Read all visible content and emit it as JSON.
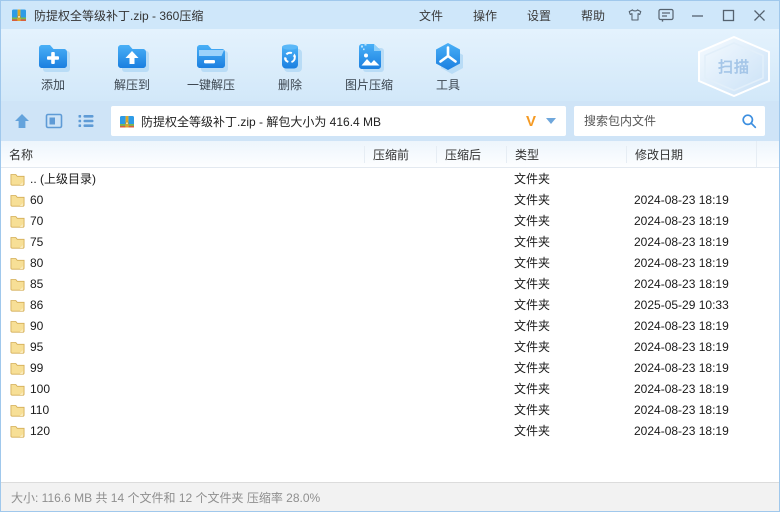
{
  "window": {
    "title": "防提权全等级补丁.zip - 360压缩",
    "menu": [
      "文件",
      "操作",
      "设置",
      "帮助"
    ]
  },
  "toolbar": {
    "buttons": [
      {
        "id": "add",
        "label": "添加"
      },
      {
        "id": "extract-to",
        "label": "解压到"
      },
      {
        "id": "one-click-extract",
        "label": "一键解压"
      },
      {
        "id": "delete",
        "label": "删除"
      },
      {
        "id": "image-compress",
        "label": "图片压缩"
      },
      {
        "id": "tools",
        "label": "工具"
      }
    ],
    "scan_label": "扫描"
  },
  "navbar": {
    "address": "防提权全等级补丁.zip - 解包大小为 416.4 MB",
    "vip_label": "V",
    "search_placeholder": "搜索包内文件"
  },
  "table": {
    "columns": [
      "名称",
      "压缩前",
      "压缩后",
      "类型",
      "修改日期"
    ],
    "rows": [
      {
        "name": ".. (上级目录)",
        "before": "",
        "after": "",
        "type": "文件夹",
        "date": ""
      },
      {
        "name": "60",
        "before": "",
        "after": "",
        "type": "文件夹",
        "date": "2024-08-23 18:19"
      },
      {
        "name": "70",
        "before": "",
        "after": "",
        "type": "文件夹",
        "date": "2024-08-23 18:19"
      },
      {
        "name": "75",
        "before": "",
        "after": "",
        "type": "文件夹",
        "date": "2024-08-23 18:19"
      },
      {
        "name": "80",
        "before": "",
        "after": "",
        "type": "文件夹",
        "date": "2024-08-23 18:19"
      },
      {
        "name": "85",
        "before": "",
        "after": "",
        "type": "文件夹",
        "date": "2024-08-23 18:19"
      },
      {
        "name": "86",
        "before": "",
        "after": "",
        "type": "文件夹",
        "date": "2025-05-29 10:33"
      },
      {
        "name": "90",
        "before": "",
        "after": "",
        "type": "文件夹",
        "date": "2024-08-23 18:19"
      },
      {
        "name": "95",
        "before": "",
        "after": "",
        "type": "文件夹",
        "date": "2024-08-23 18:19"
      },
      {
        "name": "99",
        "before": "",
        "after": "",
        "type": "文件夹",
        "date": "2024-08-23 18:19"
      },
      {
        "name": "100",
        "before": "",
        "after": "",
        "type": "文件夹",
        "date": "2024-08-23 18:19"
      },
      {
        "name": "110",
        "before": "",
        "after": "",
        "type": "文件夹",
        "date": "2024-08-23 18:19"
      },
      {
        "name": "120",
        "before": "",
        "after": "",
        "type": "文件夹",
        "date": "2024-08-23 18:19"
      }
    ]
  },
  "statusbar": {
    "text": "大小: 116.6 MB 共 14 个文件和 12 个文件夹 压缩率 28.0%"
  },
  "colors": {
    "accent_blue": "#2196f3",
    "titlebar_bg": "#cfe7fa",
    "folder_yellow": "#f7df96",
    "vip_orange": "#f59a23"
  },
  "icons": {
    "zip-file-icon": "blue zip archive",
    "shirt-icon": "skin/theme",
    "feedback-icon": "speech bubble",
    "minimize-icon": "—",
    "maximize-icon": "□",
    "close-icon": "✕",
    "up-icon": "navigate up",
    "thumbnail-view-icon": "view mode",
    "list-view-icon": "list mode",
    "search-icon": "magnifier",
    "scan-shield-icon": "antivirus scan shield",
    "folder-icon": "yellow folder"
  }
}
